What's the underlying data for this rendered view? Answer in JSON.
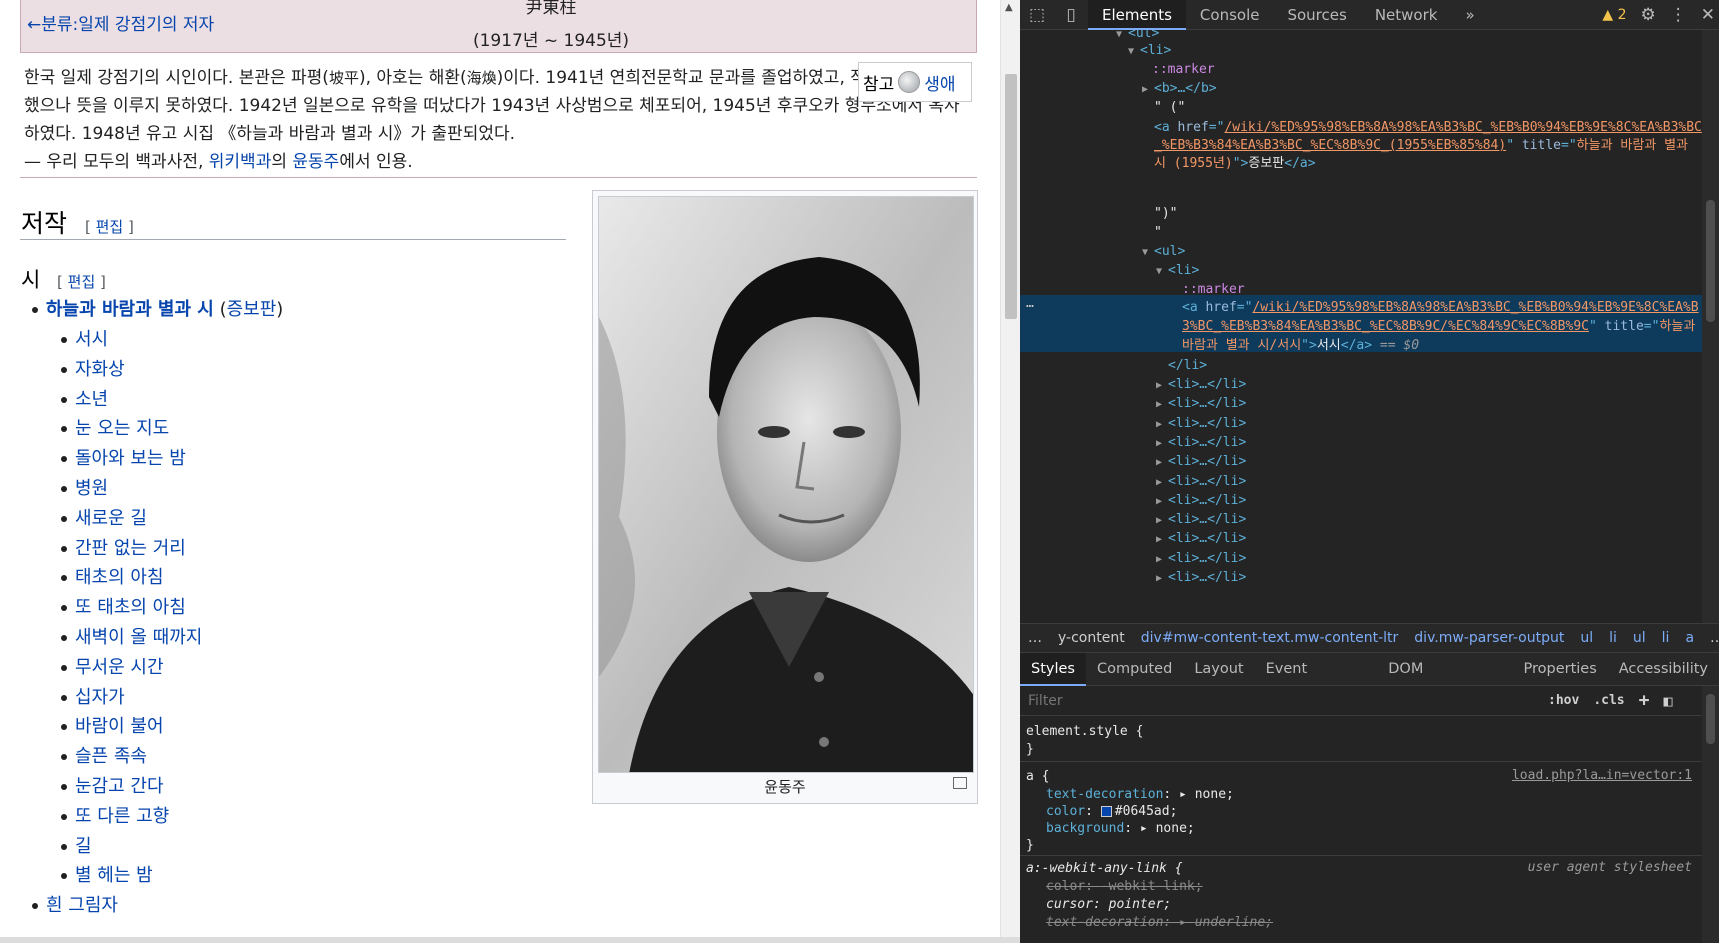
{
  "wiki": {
    "back_link": "←분류:일제 강점기의 저자",
    "title_hanja": "尹東柱",
    "years": "(1917년 ~ 1945년)",
    "summary_p1": "한국 일제 강점기의 시인이다. 본관은 파평(",
    "hanja_1": "坡平",
    "summary_p2": "), 아호는 해환(",
    "hanja_2": "海煥",
    "summary_p3": ")이다. 1941년 연희전문학교 문과를 졸업하였고, 작품집을 내려 했으나 뜻을 이루지 못하였다. 1942년 일본으로 유학을 떠났다가 1943년 사상범으로 체포되어, 1945년 후쿠오카 형무소에서 옥사하였다. 1948년 유고 시집 《하늘과 바람과 별과 시》가 출판되었다.",
    "source_prefix": "— 우리 모두의 백과사전, ",
    "source_link1": "위키백과",
    "source_mid": "의 ",
    "source_link2": "윤동주",
    "source_suffix": "에서 인용.",
    "ref_label": "참고",
    "ref_link": "생애",
    "section_title": "저작",
    "edit_label": "편집",
    "subsection_title": "시",
    "collection_title": "하늘과 바람과 별과 시",
    "collection_edition": "증보판",
    "poems": [
      "서시",
      "자화상",
      "소년",
      "눈 오는 지도",
      "돌아와 보는 밤",
      "병원",
      "새로운 길",
      "간판 없는 거리",
      "태초의 아침",
      "또 태초의 아침",
      "새벽이 올 때까지",
      "무서운 시간",
      "십자가",
      "바람이 불어",
      "슬픈 족속",
      "눈감고 간다",
      "또 다른 고향",
      "길",
      "별 헤는 밤"
    ],
    "next_item": "흰 그림자",
    "image_caption": "윤동주"
  },
  "devtools": {
    "tabs": [
      "Elements",
      "Console",
      "Sources",
      "Network"
    ],
    "more": "»",
    "warning_count": "2",
    "dom": {
      "ul": "<ul>",
      "li": "<li>",
      "marker": "::marker",
      "b_collapsed": "<b>…</b>",
      "text_open": "\" (\"",
      "a1_href": "/wiki/%ED%95%98%EB%8A%98%EA%B3%BC_%EB%B0%94%EB%9E%8C%EA%B3%BC_%EB%B3%84%EA%B3%BC_%EC%8B%9C_(1955%EB%85%84)",
      "a1_title": "하늘과 바람과 별과 시 (1955년)",
      "a1_text": "증보판",
      "text_close": "\")\"",
      "text_quote": "\"",
      "a2_href": "/wiki/%ED%95%98%EB%8A%98%EA%B3%BC_%EB%B0%94%EB%9E%8C%EA%B3%BC_%EB%B3%84%EA%B3%BC_%EC%8B%9C/%EC%84%9C%EC%8B%9C",
      "a2_title": "하늘과 바람과 별과 시/서시",
      "a2_text": "서시",
      "selected_suffix": "== $0",
      "li_close": "</li>",
      "li_collapsed": "<li>…</li>"
    },
    "breadcrumbs": [
      "y-content",
      "div#mw-content-text.mw-content-ltr",
      "div.mw-parser-output",
      "ul",
      "li",
      "ul",
      "li",
      "a"
    ],
    "subtabs": [
      "Styles",
      "Computed",
      "Layout",
      "Event Listeners",
      "DOM Breakpoints",
      "Properties",
      "Accessibility"
    ],
    "filter_placeholder": "Filter",
    "hov": ":hov",
    "cls": ".cls",
    "styles": {
      "element_style": "element.style {",
      "close": "}",
      "a_selector": "a {",
      "a_source": "load.php?la…in=vector:1",
      "a_props": [
        {
          "name": "text-decoration",
          "value": "none;"
        },
        {
          "name": "color",
          "value": "#0645ad;"
        },
        {
          "name": "background",
          "value": "none;"
        }
      ],
      "any_link_selector": "a:-webkit-any-link {",
      "ua_label": "user agent stylesheet",
      "any_link_props": [
        {
          "name": "color",
          "value": "-webkit-link;"
        },
        {
          "name": "cursor",
          "value": "pointer;"
        },
        {
          "name": "text-decoration",
          "value": "underline;"
        }
      ]
    }
  }
}
